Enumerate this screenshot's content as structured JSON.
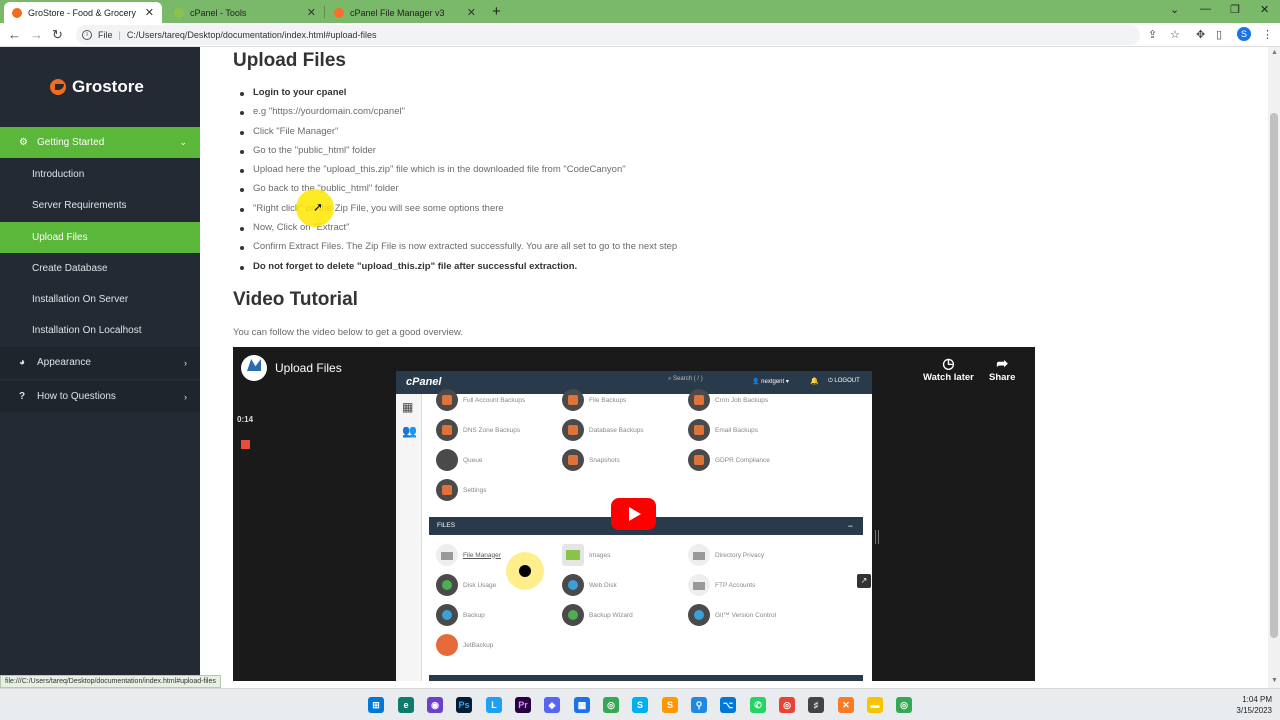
{
  "browser": {
    "tabs": [
      {
        "title": "GroStore - Food & Grocery Lara",
        "active": true
      },
      {
        "title": "cPanel - Tools",
        "active": false
      },
      {
        "title": "cPanel File Manager v3",
        "active": false
      }
    ],
    "new_tab": "+",
    "file_label": "File",
    "url": "C:/Users/tareq/Desktop/documentation/index.html#upload-files",
    "avatar_letter": "S",
    "status_url": "file:///C:/Users/tareq/Desktop/documentation/index.html#upload-files"
  },
  "sidebar": {
    "logo_text": "Grostore",
    "sections": [
      {
        "label": "Getting Started",
        "open": true
      },
      {
        "label": "Appearance",
        "open": false
      },
      {
        "label": "How to Questions",
        "open": false
      }
    ],
    "sub_items": [
      {
        "label": "Introduction"
      },
      {
        "label": "Server Requirements"
      },
      {
        "label": "Upload Files",
        "active": true
      },
      {
        "label": "Create Database"
      },
      {
        "label": "Installation On Server"
      },
      {
        "label": "Installation On Localhost"
      }
    ]
  },
  "main": {
    "upload_title": "Upload Files",
    "steps": [
      {
        "text": "Login to your cpanel",
        "bold": true
      },
      {
        "text": "e.g \"https://yourdomain.com/cpanel\""
      },
      {
        "text": "Click \"File Manager\""
      },
      {
        "text": "Go to the \"public_html\" folder"
      },
      {
        "text": "Upload here the \"upload_this.zip\" file which is in the downloaded file from \"CodeCanyon\""
      },
      {
        "text": "Go back to the \"public_html\" folder"
      },
      {
        "text": "\"Right click\" on the Zip File, you will see some options there"
      },
      {
        "text": "Now, Click on \"Extract\""
      },
      {
        "text": "Confirm Extract Files. The Zip File is now extracted successfully. You are all set to go to the next step"
      },
      {
        "text": "Do not forget to delete \"upload_this.zip\" file after successful extraction.",
        "bold": true
      }
    ],
    "video_title": "Video Tutorial",
    "video_intro": "You can follow the video below to get a good overview."
  },
  "video": {
    "title": "Upload Files",
    "watch_later": "Watch later",
    "share": "Share",
    "timestamp": "0:14",
    "cpanel": {
      "logo": "cPanel",
      "search_placeholder": "Search ( / )",
      "user": "nextgent",
      "logout": "LOGOUT",
      "files_header": "FILES",
      "top_items": [
        "Full Account Backups",
        "File Backups",
        "Cron Job Backups",
        "DNS Zone Backups",
        "Database Backups",
        "Email Backups",
        "Queue",
        "Snapshots",
        "GDPR Compliance",
        "Settings"
      ],
      "file_items": [
        "File Manager",
        "Images",
        "Directory Privacy",
        "Disk Usage",
        "Web Disk",
        "FTP Accounts",
        "Backup",
        "Backup Wizard",
        "Git™ Version Control",
        "JetBackup"
      ]
    }
  },
  "taskbar": {
    "time": "1:04 PM",
    "date": "3/15/2023"
  }
}
